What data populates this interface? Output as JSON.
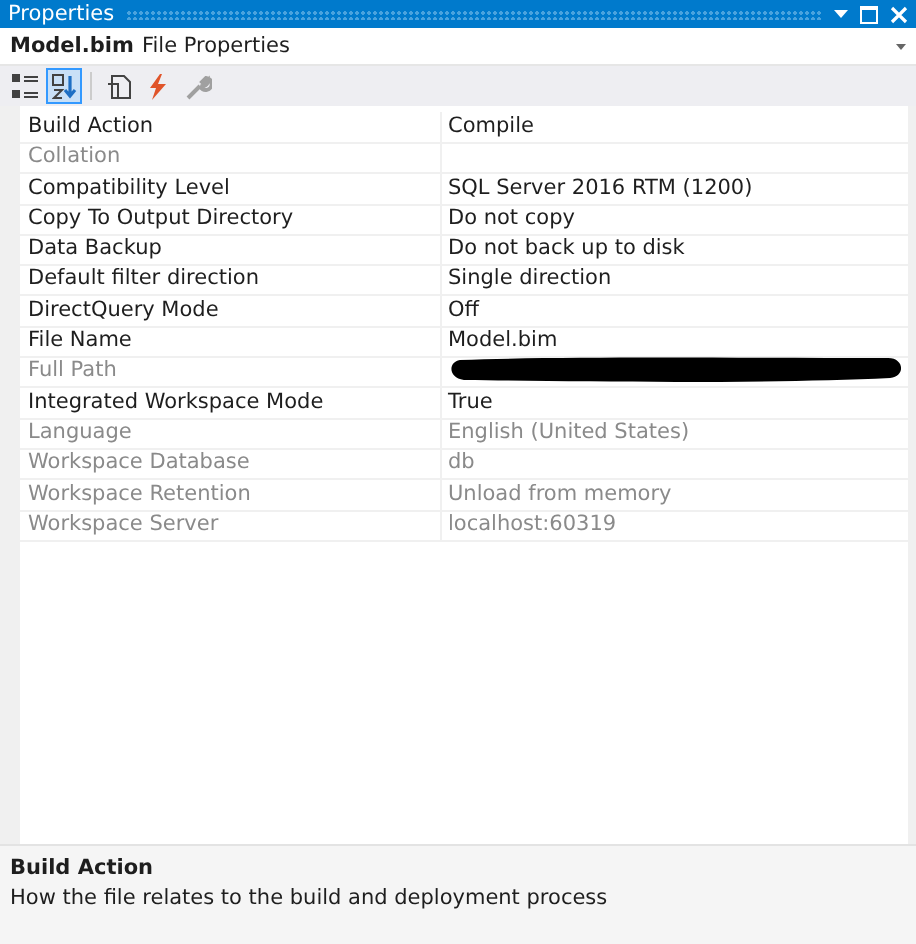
{
  "window": {
    "title": "Properties"
  },
  "object": {
    "name": "Model.bim",
    "type": "File Properties"
  },
  "toolbar": [
    {
      "kind": "categorized",
      "selected": false
    },
    {
      "kind": "alphabetical",
      "selected": true
    },
    {
      "kind": "pages",
      "selected": false
    },
    {
      "kind": "events",
      "selected": false
    },
    {
      "kind": "wrench",
      "selected": false
    }
  ],
  "properties": [
    {
      "name": "Build Action",
      "value": "Compile",
      "disabled": false
    },
    {
      "name": "Collation",
      "disabled": true
    },
    {
      "name": "Compatibility Level",
      "value": "SQL Server 2016 RTM (1200)",
      "disabled": false
    },
    {
      "name": "Copy To Output Directory",
      "value": "Do not copy",
      "disabled": false
    },
    {
      "name": "Data Backup",
      "value": "Do not back up to disk",
      "disabled": false
    },
    {
      "name": "Default filter direction",
      "value": "Single direction",
      "disabled": false
    },
    {
      "name": "DirectQuery Mode",
      "value": "Off",
      "disabled": false
    },
    {
      "name": "File Name",
      "value": "Model.bim",
      "disabled": false
    },
    {
      "name": "Full Path",
      "disabled": true,
      "redacted": true
    },
    {
      "name": "Integrated Workspace Mode",
      "value": "True",
      "disabled": false
    },
    {
      "name": "Language",
      "value": "English (United States)",
      "disabled": true
    },
    {
      "name": "Workspace Database",
      "value": "db",
      "disabled": true
    },
    {
      "name": "Workspace Retention",
      "value": "Unload from memory",
      "disabled": true
    },
    {
      "name": "Workspace Server",
      "value": "localhost:60319",
      "disabled": true
    }
  ],
  "description": {
    "title": "Build Action",
    "text": "How the file relates to the build and deployment process"
  }
}
